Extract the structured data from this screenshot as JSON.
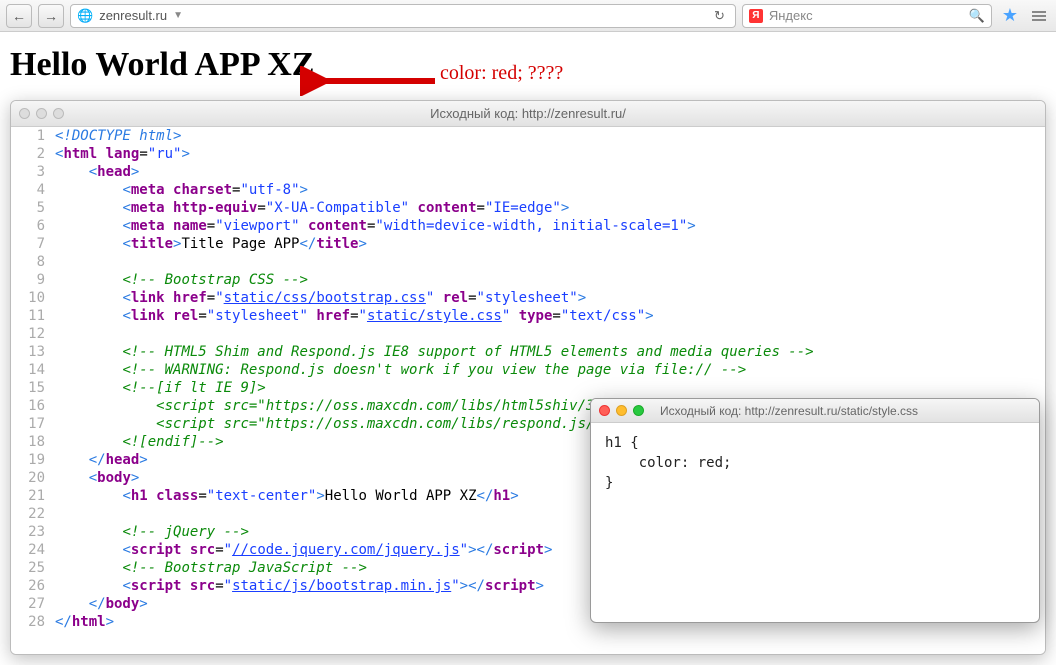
{
  "browser": {
    "url": "zenresult.ru",
    "search_placeholder": "Яндекс"
  },
  "page": {
    "heading": "Hello World APP XZ"
  },
  "annotation": {
    "text": "color: red; ????"
  },
  "source_window": {
    "title": "Исходный код: http://zenresult.ru/"
  },
  "style_window": {
    "title": "Исходный код: http://zenresult.ru/static/style.css",
    "code": "h1 {\n    color: red;\n}"
  },
  "code_lines": [
    {
      "n": 1,
      "t": "doctype",
      "text": "<!DOCTYPE html>"
    },
    {
      "n": 2,
      "t": "tag",
      "tag": "html",
      "attrs": [
        [
          "lang",
          "ru"
        ]
      ],
      "open": true,
      "indent": 0
    },
    {
      "n": 3,
      "t": "tag",
      "tag": "head",
      "open": true,
      "indent": 1
    },
    {
      "n": 4,
      "t": "tag",
      "tag": "meta",
      "attrs": [
        [
          "charset",
          "utf-8"
        ]
      ],
      "self": true,
      "indent": 2
    },
    {
      "n": 5,
      "t": "tag",
      "tag": "meta",
      "attrs": [
        [
          "http-equiv",
          "X-UA-Compatible"
        ],
        [
          "content",
          "IE=edge"
        ]
      ],
      "self": true,
      "indent": 2
    },
    {
      "n": 6,
      "t": "tag",
      "tag": "meta",
      "attrs": [
        [
          "name",
          "viewport"
        ],
        [
          "content",
          "width=device-width, initial-scale=1"
        ]
      ],
      "self": true,
      "indent": 2
    },
    {
      "n": 7,
      "t": "tagtext",
      "tag": "title",
      "text": "Title Page APP",
      "indent": 2
    },
    {
      "n": 8,
      "t": "blank"
    },
    {
      "n": 9,
      "t": "com",
      "text": "<!-- Bootstrap CSS -->",
      "indent": 2
    },
    {
      "n": 10,
      "t": "tag",
      "tag": "link",
      "attrs": [
        [
          "href",
          "static/css/bootstrap.css",
          "link"
        ],
        [
          "rel",
          "stylesheet"
        ]
      ],
      "self": true,
      "indent": 2
    },
    {
      "n": 11,
      "t": "tag",
      "tag": "link",
      "attrs": [
        [
          "rel",
          "stylesheet"
        ],
        [
          "href",
          "static/style.css",
          "link"
        ],
        [
          "type",
          "text/css"
        ]
      ],
      "self": true,
      "indent": 2
    },
    {
      "n": 12,
      "t": "blank"
    },
    {
      "n": 13,
      "t": "com",
      "text": "<!-- HTML5 Shim and Respond.js IE8 support of HTML5 elements and media queries -->",
      "indent": 2
    },
    {
      "n": 14,
      "t": "com",
      "text": "<!-- WARNING: Respond.js doesn't work if you view the page via file:// -->",
      "indent": 2
    },
    {
      "n": 15,
      "t": "com",
      "text": "<!--[if lt IE 9]>",
      "indent": 2
    },
    {
      "n": 16,
      "t": "com",
      "text": "<script src=\"https://oss.maxcdn.com/libs/html5shiv/3.7.",
      "indent": 3
    },
    {
      "n": 17,
      "t": "com",
      "text": "<script src=\"https://oss.maxcdn.com/libs/respond.js/1.4",
      "indent": 3
    },
    {
      "n": 18,
      "t": "com",
      "text": "<![endif]-->",
      "indent": 2
    },
    {
      "n": 19,
      "t": "close",
      "tag": "head",
      "indent": 1
    },
    {
      "n": 20,
      "t": "tag",
      "tag": "body",
      "open": true,
      "indent": 1
    },
    {
      "n": 21,
      "t": "tagtext",
      "tag": "h1",
      "attrs": [
        [
          "class",
          "text-center"
        ]
      ],
      "text": "Hello World APP XZ",
      "indent": 2
    },
    {
      "n": 22,
      "t": "blank"
    },
    {
      "n": 23,
      "t": "com",
      "text": "<!-- jQuery -->",
      "indent": 2
    },
    {
      "n": 24,
      "t": "scripttag",
      "attrs": [
        [
          "src",
          "//code.jquery.com/jquery.js",
          "link"
        ]
      ],
      "indent": 2
    },
    {
      "n": 25,
      "t": "com",
      "text": "<!-- Bootstrap JavaScript -->",
      "indent": 2
    },
    {
      "n": 26,
      "t": "scripttag",
      "attrs": [
        [
          "src",
          "static/js/bootstrap.min.js",
          "link"
        ]
      ],
      "indent": 2
    },
    {
      "n": 27,
      "t": "close",
      "tag": "body",
      "indent": 1
    },
    {
      "n": 28,
      "t": "close",
      "tag": "html",
      "indent": 0
    }
  ]
}
